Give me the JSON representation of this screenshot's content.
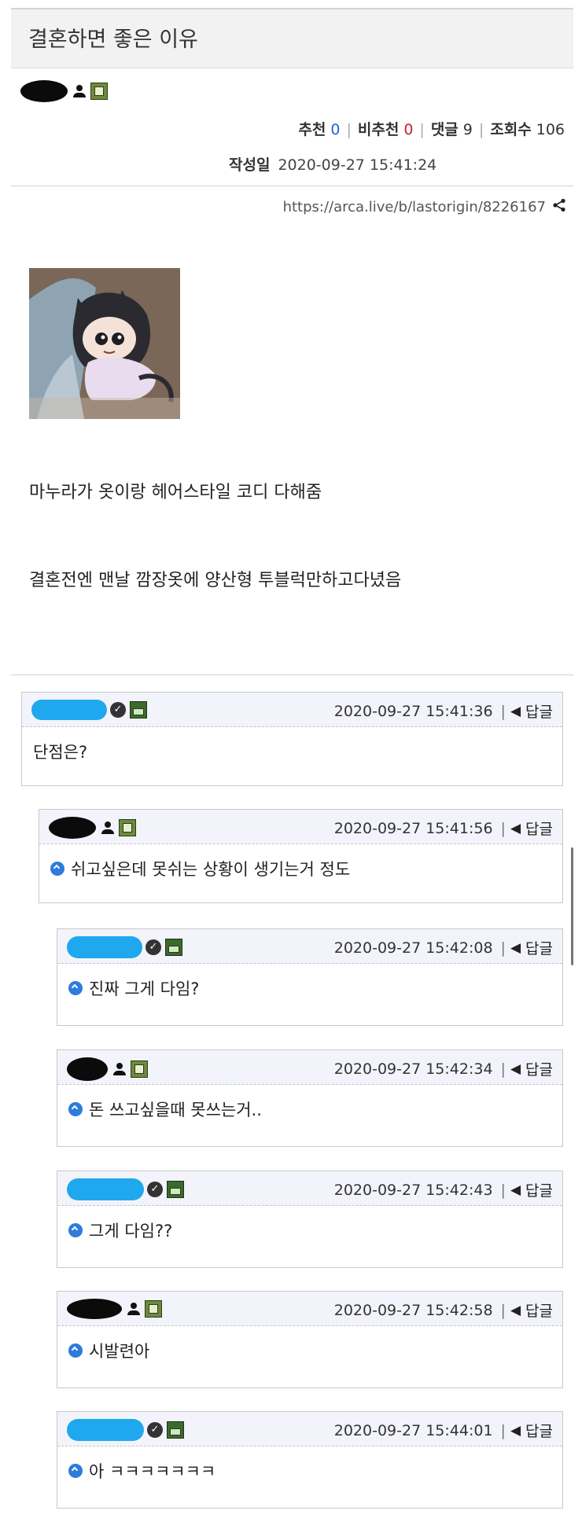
{
  "post": {
    "title": "결혼하면 좋은 이유",
    "stats": {
      "recommend_label": "추천",
      "recommend_value": "0",
      "downvote_label": "비추천",
      "downvote_value": "0",
      "comments_label": "댓글",
      "comments_value": "9",
      "views_label": "조회수",
      "views_value": "106"
    },
    "date_label": "작성일",
    "date_value": "2020-09-27 15:41:24",
    "url": "https://arca.live/b/lastorigin/8226167",
    "body_lines": [
      "마누라가 옷이랑 헤어스타일 코디 다해줌",
      "결혼전엔 맨날 깜장옷에 양산형 투블럭만하고다녔음"
    ]
  },
  "reply_label": "답글",
  "comments": [
    {
      "timestamp": "2020-09-27 15:41:36",
      "text": "단점은?"
    },
    {
      "timestamp": "2020-09-27 15:41:56",
      "text": "쉬고싶은데 못쉬는 상황이 생기는거 정도"
    },
    {
      "timestamp": "2020-09-27 15:42:08",
      "text": "진짜 그게 다임?"
    },
    {
      "timestamp": "2020-09-27 15:42:34",
      "text": "돈 쓰고싶을때 못쓰는거.."
    },
    {
      "timestamp": "2020-09-27 15:42:43",
      "text": "그게 다임??"
    },
    {
      "timestamp": "2020-09-27 15:42:58",
      "text": "시발련아"
    },
    {
      "timestamp": "2020-09-27 15:44:01",
      "text": "아 ㅋㅋㅋㅋㅋㅋㅋ"
    }
  ],
  "icons": {
    "user": "person-icon",
    "level": "level-badge-icon",
    "verified": "check-circle-icon",
    "reply": "reply-arrow-icon",
    "share": "share-icon",
    "reply_indicator": "reply-dot-icon"
  },
  "colors": {
    "blue_count": "#1b67d6",
    "red_count": "#c82333",
    "comment_header": "#f3f4fb",
    "redaction_black": "#0b0b0b",
    "redaction_blue": "#1fa8ee"
  }
}
